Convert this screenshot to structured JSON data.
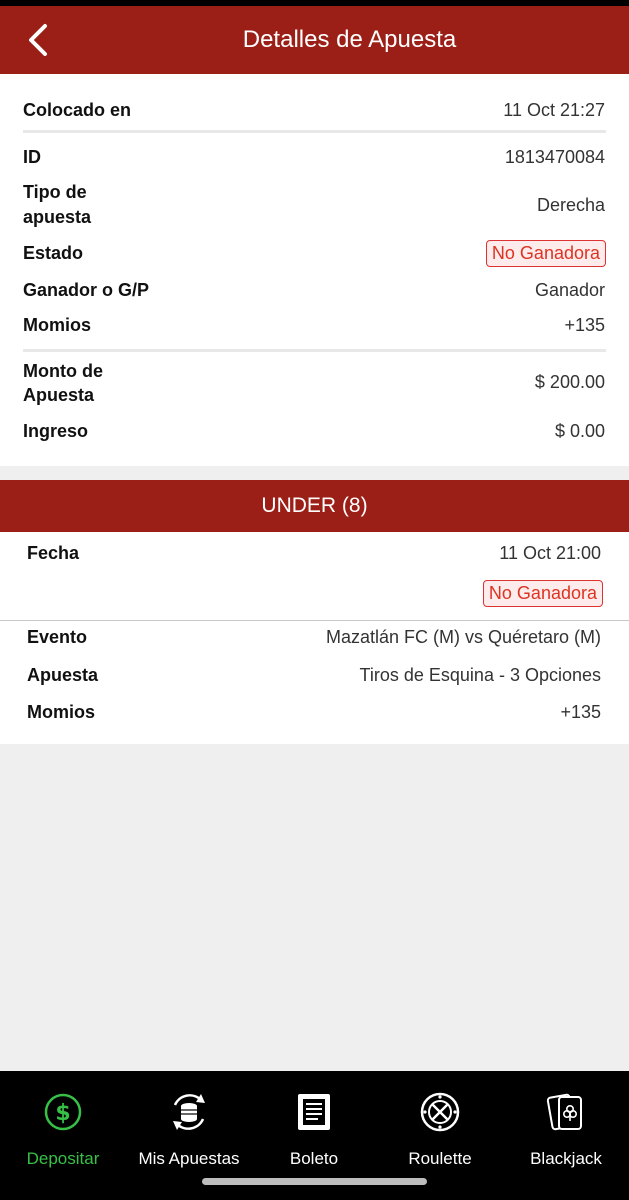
{
  "header": {
    "title": "Detalles de Apuesta"
  },
  "summary": {
    "placed_label": "Colocado en",
    "placed_value": "11 Oct 21:27",
    "id_label": "ID",
    "id_value": "1813470084",
    "type_label_1": "Tipo de",
    "type_label_2": "apuesta",
    "type_value": "Derecha",
    "status_label": "Estado",
    "status_value": "No Ganadora",
    "winner_label": "Ganador o G/P",
    "winner_value": "Ganador",
    "odds_label": "Momios",
    "odds_value": "+135",
    "amount_label_1": "Monto de",
    "amount_label_2": "Apuesta",
    "amount_value": "$ 200.00",
    "income_label": "Ingreso",
    "income_value": "$ 0.00"
  },
  "selection": {
    "title": "UNDER (8)",
    "date_label": "Fecha",
    "date_value": "11 Oct 21:00",
    "status_value": "No Ganadora",
    "event_label": "Evento",
    "event_value": "Mazatlán FC (M) vs Quéretaro (M)",
    "bet_label": "Apuesta",
    "bet_value": "Tiros de Esquina - 3 Opciones",
    "odds_label": "Momios",
    "odds_value": "+135"
  },
  "nav": {
    "items": [
      {
        "label": "Depositar",
        "icon": "dollar-circle-icon",
        "active": true
      },
      {
        "label": "Mis Apuestas",
        "icon": "coins-cycle-icon",
        "active": false
      },
      {
        "label": "Boleto",
        "icon": "ticket-icon",
        "active": false
      },
      {
        "label": "Roulette",
        "icon": "roulette-wheel-icon",
        "active": false
      },
      {
        "label": "Blackjack",
        "icon": "cards-icon",
        "active": false
      }
    ]
  },
  "colors": {
    "header": "#9b1f16",
    "accent_green": "#37c047",
    "badge_red": "#d33333"
  }
}
